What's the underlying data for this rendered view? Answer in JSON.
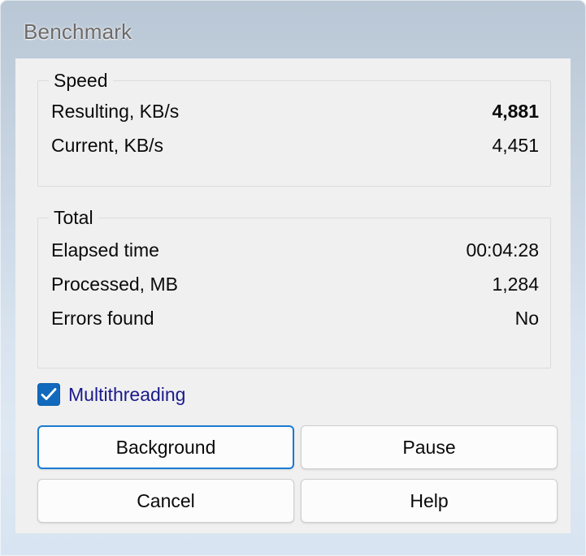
{
  "window": {
    "title": "Benchmark",
    "accent_blue": "#1a7ad4",
    "checkbox_blue": "#1169bd",
    "titlebar_top": "#b9c7d6",
    "titlebar_bottom": "#d8e4f1",
    "client_bg": "#f0f0f0"
  },
  "groups": [
    {
      "legend": "Speed",
      "rows": [
        {
          "label": "Resulting, KB/s",
          "value": "4,881",
          "bold": true
        },
        {
          "label": "Current, KB/s",
          "value": "4,451",
          "bold": false
        }
      ]
    },
    {
      "legend": "Total",
      "rows": [
        {
          "label": "Elapsed time",
          "value": "00:04:28",
          "bold": false
        },
        {
          "label": "Processed, MB",
          "value": "1,284",
          "bold": false
        },
        {
          "label": "Errors found",
          "value": "No",
          "bold": false
        }
      ]
    }
  ],
  "options": {
    "multithreading": {
      "label": "Multithreading",
      "checked": true
    }
  },
  "buttons": {
    "background": "Background",
    "pause": "Pause",
    "cancel": "Cancel",
    "help": "Help"
  }
}
